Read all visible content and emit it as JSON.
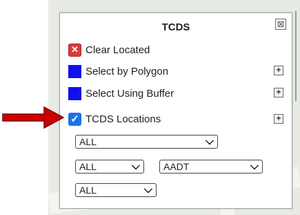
{
  "panel": {
    "title": "TCDS",
    "close_glyph": "⊠",
    "items": [
      {
        "label": "Clear Located",
        "icon": "clear-x-icon",
        "color": "#d93a3a"
      },
      {
        "label": "Select by Polygon",
        "icon": "blue-square-icon",
        "color": "#1010ee"
      },
      {
        "label": "Select Using Buffer",
        "icon": "blue-square-icon",
        "color": "#1010ee"
      },
      {
        "label": "TCDS Locations",
        "icon": "checkbox-checked-icon",
        "checked": true
      }
    ],
    "plus_glyph": "+",
    "selects": [
      {
        "value": "ALL"
      },
      {
        "value": "ALL"
      },
      {
        "value": "AADT"
      },
      {
        "value": "ALL"
      }
    ]
  },
  "annotation": {
    "arrow_color": "#cc0000"
  }
}
